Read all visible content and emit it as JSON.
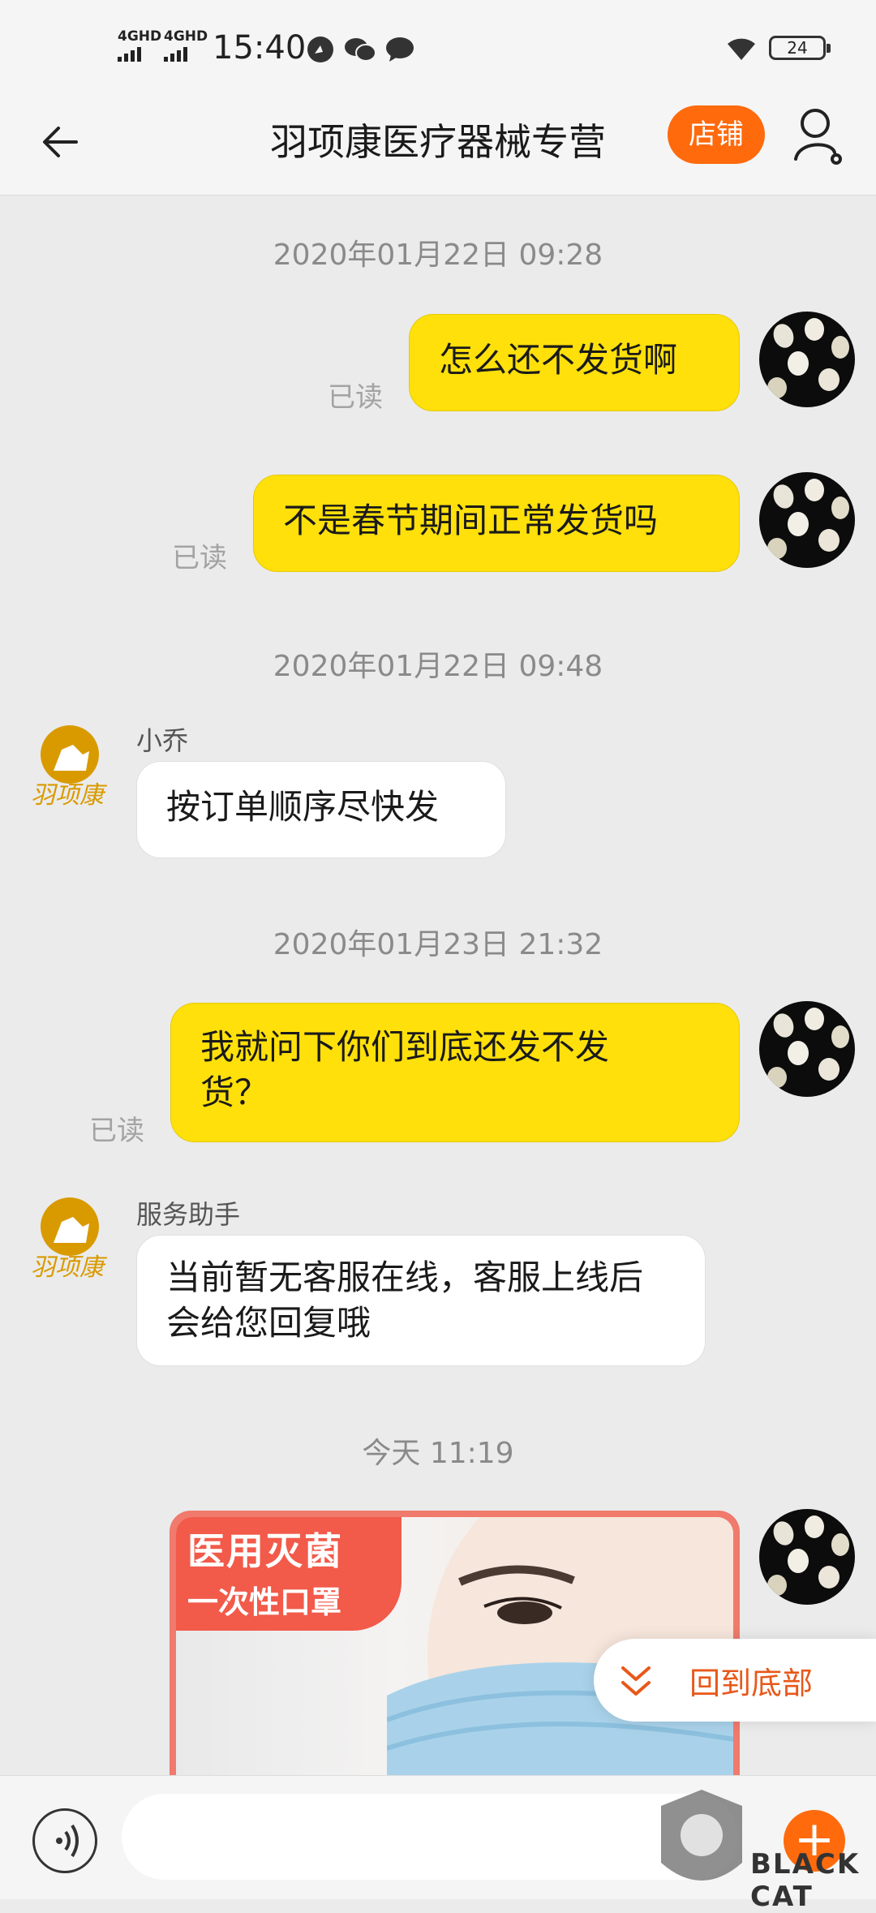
{
  "status_bar": {
    "signal_1": "4GHD",
    "signal_2": "4GHD",
    "time": "15:40",
    "battery": "24"
  },
  "header": {
    "title": "羽项康医疗器械专营",
    "store_button": "店铺"
  },
  "messages": {
    "ts1": "2020年01月22日 09:28",
    "m1": "怎么还不发货啊",
    "m1_read": "已读",
    "m2": "不是春节期间正常发货吗",
    "m2_read": "已读",
    "ts2": "2020年01月22日 09:48",
    "shop1_name": "小乔",
    "shop1_msg": "按订单顺序尽快发",
    "ts3": "2020年01月23日 21:32",
    "m3_line1": "我就问下你们到底还发不发",
    "m3_line2": "货？",
    "m3_read": "已读",
    "shop2_name": "服务助手",
    "shop2_line1": "当前暂无客服在线，客服上线后",
    "shop2_line2": "会给您回复哦",
    "ts4": "今天  11:19"
  },
  "product_card": {
    "tag_line1": "医用灭菌",
    "tag_line2": "一次性口罩"
  },
  "back_to_bottom": "回到底部",
  "input": {
    "placeholder": ""
  },
  "logo_text": "羽项康",
  "watermark": "BLACK CAT",
  "colors": {
    "accent_orange": "#ff6a0d",
    "my_bubble": "#ffe00a",
    "logo_gold": "#d99a00"
  }
}
